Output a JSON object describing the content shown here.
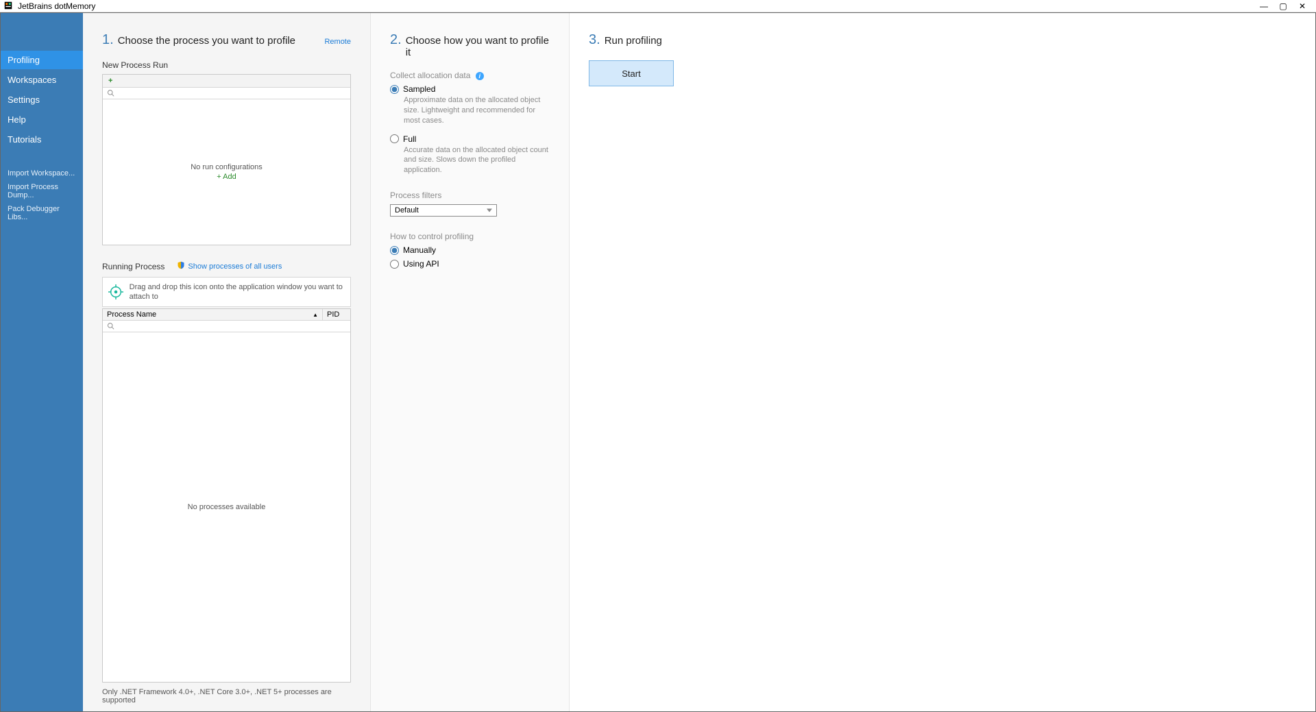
{
  "app": {
    "title": "JetBrains dotMemory"
  },
  "sidebar": {
    "nav": [
      "Profiling",
      "Workspaces",
      "Settings",
      "Help",
      "Tutorials"
    ],
    "active_index": 0,
    "sub": [
      "Import Workspace...",
      "Import Process Dump...",
      "Pack Debugger Libs..."
    ]
  },
  "step1": {
    "num": "1.",
    "title": "Choose the process you want to profile",
    "remote": "Remote",
    "new_run_label": "New Process Run",
    "no_config": "No run configurations",
    "add": "Add",
    "running_label": "Running Process",
    "show_all": "Show processes of all users",
    "attach_hint": "Drag and drop this icon onto the application window you want to attach to",
    "col_name": "Process Name",
    "col_pid": "PID",
    "no_proc": "No processes available",
    "footnote": "Only .NET Framework 4.0+, .NET Core 3.0+, .NET 5+ processes are supported"
  },
  "step2": {
    "num": "2.",
    "title": "Choose how you want to profile it",
    "alloc_label": "Collect allocation data",
    "sampled": {
      "label": "Sampled",
      "desc": "Approximate data on the allocated object size. Lightweight and recommended for most cases."
    },
    "full": {
      "label": "Full",
      "desc": "Accurate data on the allocated object count and size. Slows down the profiled application."
    },
    "filters_label": "Process filters",
    "filters_value": "Default",
    "control_label": "How to control profiling",
    "control_manually": "Manually",
    "control_api": "Using API"
  },
  "step3": {
    "num": "3.",
    "title": "Run profiling",
    "start": "Start"
  }
}
